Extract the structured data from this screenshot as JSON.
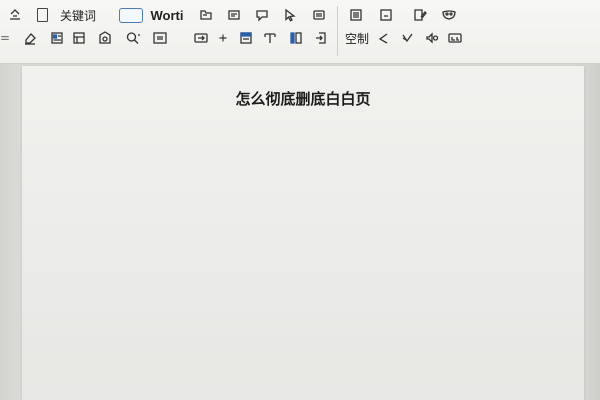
{
  "toolbar": {
    "row1": {
      "keyword_label": "关键词",
      "wordart_label": "Worti"
    },
    "row2": {
      "control_label": "空制"
    }
  },
  "document": {
    "title": "怎么彻底删底白白页"
  },
  "colors": {
    "accent": "#2a5fa8",
    "textbox_border": "#4a7bb5",
    "page_bg": "#efefec"
  },
  "icons": [
    "collapse-icon",
    "checkbox-icon",
    "textbox-icon",
    "folder-icon",
    "frame-icon",
    "comment-icon",
    "cursor-icon",
    "picture-icon",
    "list-icon",
    "layout-icon",
    "edit-icon",
    "mask-icon",
    "equals-icon",
    "eraser-icon",
    "form-icon",
    "table-icon",
    "shape-icon",
    "search-icon",
    "field-icon",
    "link-icon",
    "plus-icon",
    "header-icon",
    "paragraph-icon",
    "column-icon",
    "return-icon",
    "check-icon",
    "brush-icon",
    "sound-icon",
    "label-icon"
  ]
}
